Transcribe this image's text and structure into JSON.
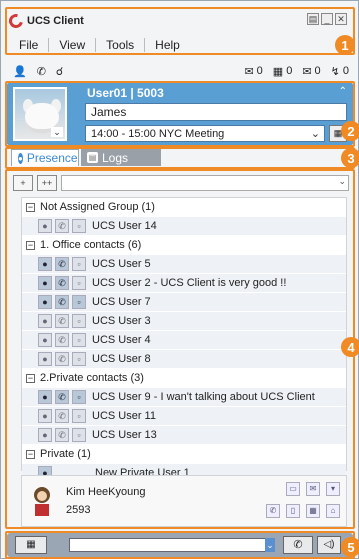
{
  "app": {
    "title": "UCS Client"
  },
  "window_controls": [
    "restore",
    "minimize",
    "close"
  ],
  "menu": [
    {
      "label": "File"
    },
    {
      "label": "View"
    },
    {
      "label": "Tools"
    },
    {
      "label": "Help"
    }
  ],
  "status_counts": [
    {
      "icon": "voicemail-icon",
      "value": "0"
    },
    {
      "icon": "fax-icon",
      "value": "0"
    },
    {
      "icon": "message-icon",
      "value": "0"
    },
    {
      "icon": "call-log-icon",
      "value": "0"
    }
  ],
  "profile": {
    "user": "User01 | 5003",
    "display_name": "James",
    "meeting": "14:00 - 15:00 NYC Meeting",
    "panel_color": "#5a9fd4"
  },
  "tabs": [
    {
      "label": "Presence"
    },
    {
      "label": "Logs"
    }
  ],
  "contacts": {
    "groups": [
      {
        "name": "Not Assigned Group (1)",
        "members": [
          {
            "name": "UCS User 14"
          }
        ]
      },
      {
        "name": "1. Office contacts (6)",
        "members": [
          {
            "name": "UCS User 5"
          },
          {
            "name": "UCS User 2 - UCS Client is very good !!"
          },
          {
            "name": "UCS User 7"
          },
          {
            "name": "UCS User 3"
          },
          {
            "name": "UCS User 4"
          },
          {
            "name": "UCS User 8"
          }
        ]
      },
      {
        "name": "2.Private contacts (3)",
        "members": [
          {
            "name": "UCS User 9 - I wan't talking about UCS Client"
          },
          {
            "name": "UCS User 11"
          },
          {
            "name": "UCS User 13"
          }
        ]
      },
      {
        "name": "Private (1)",
        "members": [
          {
            "name": "New Private User 1"
          }
        ]
      }
    ]
  },
  "selected_contact": {
    "name": "Kim HeeKyoung",
    "number": "2593"
  },
  "callouts": [
    "1",
    "2",
    "3",
    "4",
    "5"
  ],
  "accent_color": "#f08a24"
}
